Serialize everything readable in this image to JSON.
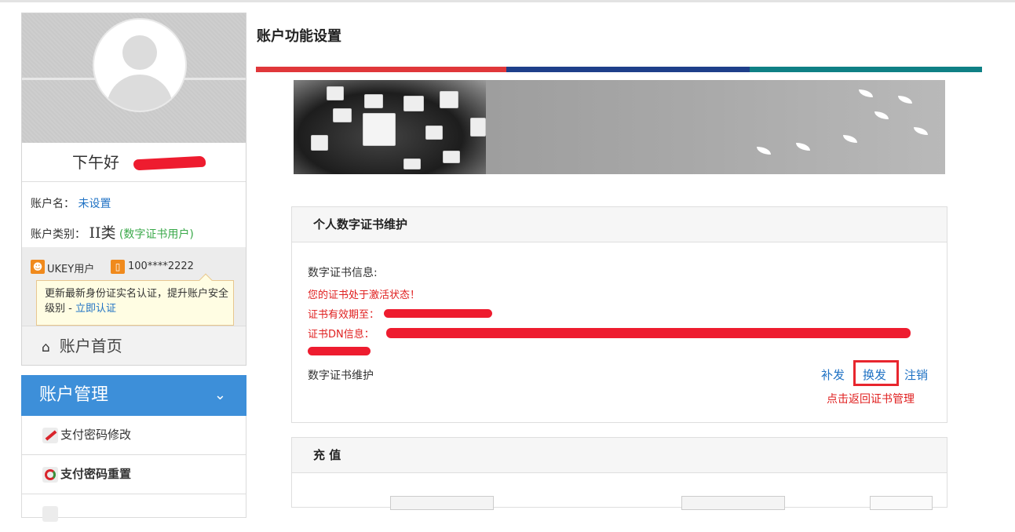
{
  "sidebar": {
    "greeting": "下午好",
    "account_name_label": "账户名：",
    "account_name_value": "未设置",
    "account_type_label": "账户类别：",
    "account_type_value": "II类",
    "account_type_note": "(数字证书用户)",
    "ukey_label": "UKEY用户",
    "phone": "100****2222",
    "tooltip_text": "更新最新身份证实名认证，提升账户安全级别 - ",
    "tooltip_link": "立即认证",
    "home_label": "账户首页",
    "account_mgmt_label": "账户管理",
    "menu": [
      "支付密码修改",
      "支付密码重置"
    ]
  },
  "main": {
    "title": "账户功能设置",
    "colors": {
      "red": "#e0373a",
      "blue": "#1e3f8a",
      "teal": "#0f8085"
    },
    "cert_panel": {
      "title": "个人数字证书维护",
      "info_label": "数字证书信息:",
      "status": "您的证书处于激活状态！",
      "expiry_label": "证书有效期至：",
      "dn_label": "证书DN信息：",
      "maintenance_label": "数字证书维护",
      "actions": [
        "补发",
        "换发",
        "注销"
      ],
      "back_link": "点击返回证书管理"
    },
    "recharge_panel": {
      "title": "充 值"
    }
  }
}
